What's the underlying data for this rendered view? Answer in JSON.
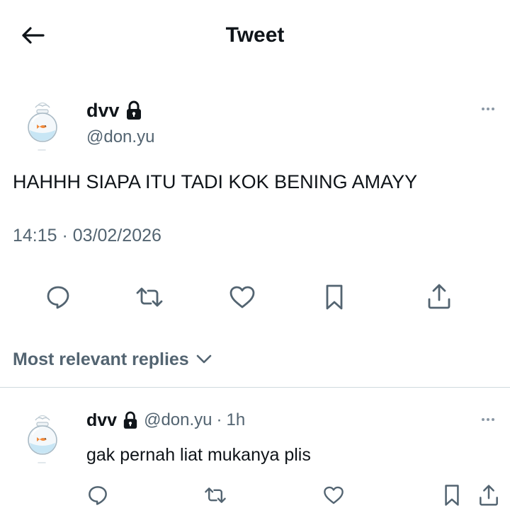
{
  "header": {
    "title": "Tweet"
  },
  "tweet": {
    "author_name": "dvv",
    "handle": "@don.yu",
    "text": "HAHHH SIAPA ITU TADI KOK BENING AMAYY",
    "timestamp": "14:15 · 03/02/2026"
  },
  "replies_section": {
    "label": "Most relevant replies"
  },
  "reply": {
    "author_name": "dvv",
    "handle": "@don.yu",
    "separator": "·",
    "time": "1h",
    "text": "gak pernah liat mukanya plis"
  },
  "icons": {
    "back": "arrow-left-icon",
    "lock": "lock-icon",
    "more": "more-horizontal-icon",
    "reply": "reply-bubble-icon",
    "retweet": "retweet-icon",
    "like": "heart-icon",
    "bookmark": "bookmark-icon",
    "share": "share-icon",
    "avatar": "fishbowl-avatar-icon",
    "chevron": "chevron-down-icon"
  },
  "colors": {
    "text_primary": "#0f1419",
    "text_secondary": "#536471",
    "divider": "#cfd9de",
    "background": "#ffffff"
  }
}
